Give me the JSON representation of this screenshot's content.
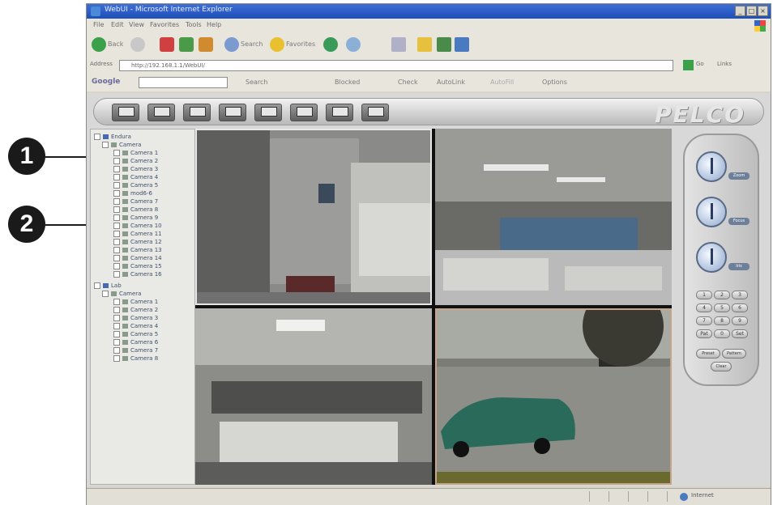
{
  "callouts": [
    {
      "number": "1"
    },
    {
      "number": "2"
    }
  ],
  "browser": {
    "title": "WebUI - Microsoft Internet Explorer",
    "menu": [
      "File",
      "Edit",
      "View",
      "Favorites",
      "Tools",
      "Help"
    ],
    "toolbar": {
      "back": "Back",
      "search": "Search",
      "favorites": "Favorites"
    },
    "address_label": "Address",
    "address_value": "http://192.168.1.1/WebUI/",
    "go_label": "Go",
    "links_label": "Links",
    "google": {
      "label": "Google",
      "search": "Search",
      "blocked": "Blocked",
      "check": "Check",
      "autolink": "AutoLink",
      "autofill": "AutoFill",
      "options": "Options"
    },
    "status_zone": "Internet"
  },
  "app": {
    "brand": "PELCO",
    "layout_buttons": [
      "1x1",
      "2x2",
      "3x3",
      "1+5",
      "1+7",
      "4x4",
      "5x5",
      "camera-select"
    ],
    "tree": {
      "groups": [
        {
          "name": "Endura",
          "folder": "Camera",
          "cameras": [
            "Camera 1",
            "Camera 2",
            "Camera 3",
            "Camera 4",
            "Camera 5",
            "mod6-6",
            "Camera 7",
            "Camera 8",
            "Camera 9",
            "Camera 10",
            "Camera 11",
            "Camera 12",
            "Camera 13",
            "Camera 14",
            "Camera 15",
            "Camera 16"
          ]
        },
        {
          "name": "Lab",
          "folder": "Camera",
          "cameras": [
            "Camera 1",
            "Camera 2",
            "Camera 3",
            "Camera 4",
            "Camera 5",
            "Camera 6",
            "Camera 7",
            "Camera 8"
          ]
        }
      ]
    },
    "feeds": [
      {
        "scene": "hallway"
      },
      {
        "scene": "office"
      },
      {
        "scene": "cubicles"
      },
      {
        "scene": "parking"
      }
    ],
    "ptz": {
      "knob_labels": [
        "Zoom",
        "Focus",
        "Iris"
      ],
      "keypad": [
        "1",
        "2",
        "3",
        "4",
        "5",
        "6",
        "7",
        "8",
        "9",
        "Pat",
        "0",
        "Set"
      ],
      "buttons": [
        "Preset",
        "Pattern",
        "Clear"
      ]
    }
  }
}
